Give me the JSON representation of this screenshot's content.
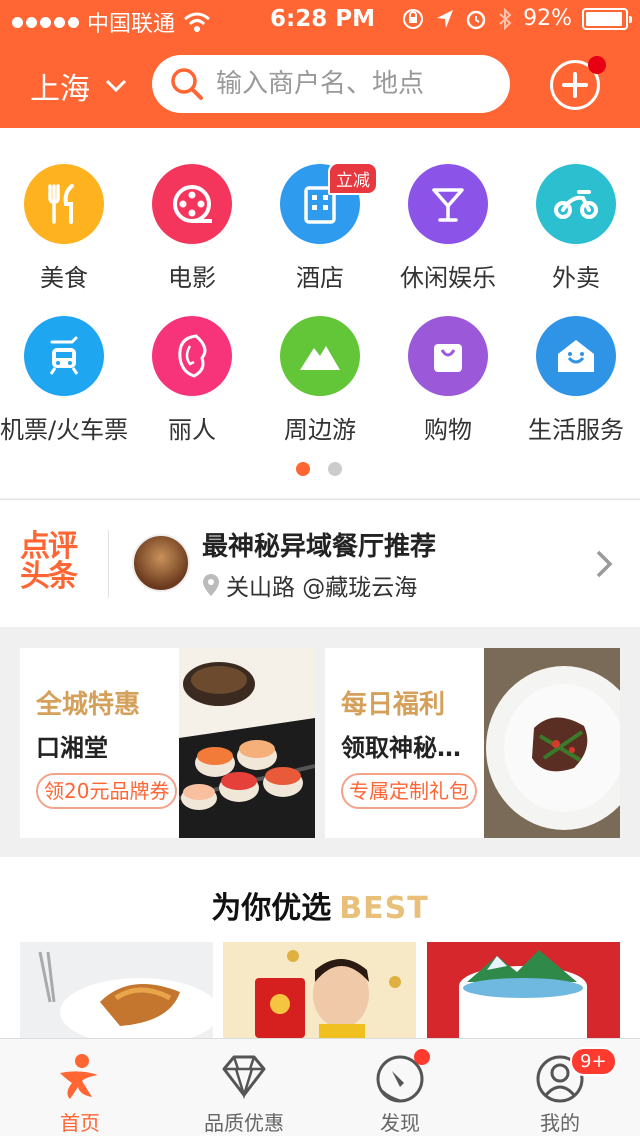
{
  "status_bar": {
    "carrier": "中国联通",
    "time": "6:28 PM",
    "battery": "92%"
  },
  "header": {
    "city": "上海",
    "search_placeholder": "输入商户名、地点"
  },
  "categories": [
    {
      "label": "美食",
      "icon": "fork-knife-icon",
      "color": "#ffb21f"
    },
    {
      "label": "电影",
      "icon": "film-reel-icon",
      "color": "#f5365c"
    },
    {
      "label": "酒店",
      "icon": "hotel-icon",
      "color": "#2f9bef",
      "badge": "立减"
    },
    {
      "label": "休闲娱乐",
      "icon": "cocktail-icon",
      "color": "#8c53e8"
    },
    {
      "label": "外卖",
      "icon": "scooter-icon",
      "color": "#2bbfd0"
    },
    {
      "label": "机票/火车票",
      "icon": "train-plane-icon",
      "color": "#1ea7f0"
    },
    {
      "label": "丽人",
      "icon": "lady-icon",
      "color": "#f7337a"
    },
    {
      "label": "周边游",
      "icon": "mountain-icon",
      "color": "#63c638"
    },
    {
      "label": "购物",
      "icon": "shopping-bag-icon",
      "color": "#9b58d8"
    },
    {
      "label": "生活服务",
      "icon": "house-icon",
      "color": "#2f94e6"
    }
  ],
  "headline": {
    "logo_line1": "点评",
    "logo_line2": "头条",
    "title": "最神秘异域餐厅推荐",
    "subtitle": "关山路 @藏珑云海"
  },
  "promos": [
    {
      "tag": "全城特惠",
      "name": "口湘堂",
      "button": "领20元品牌券"
    },
    {
      "tag": "每日福利",
      "name": "领取神秘…",
      "button": "专属定制礼包"
    }
  ],
  "best": {
    "title": "为你优选",
    "title_en": "BEST"
  },
  "tabs": [
    {
      "label": "首页",
      "icon": "home-person-icon"
    },
    {
      "label": "品质优惠",
      "icon": "diamond-icon"
    },
    {
      "label": "发现",
      "icon": "compass-icon"
    },
    {
      "label": "我的",
      "icon": "profile-icon",
      "badge": "9+"
    }
  ],
  "colors": {
    "brand": "#ff6633",
    "gold": "#d4a05a"
  }
}
